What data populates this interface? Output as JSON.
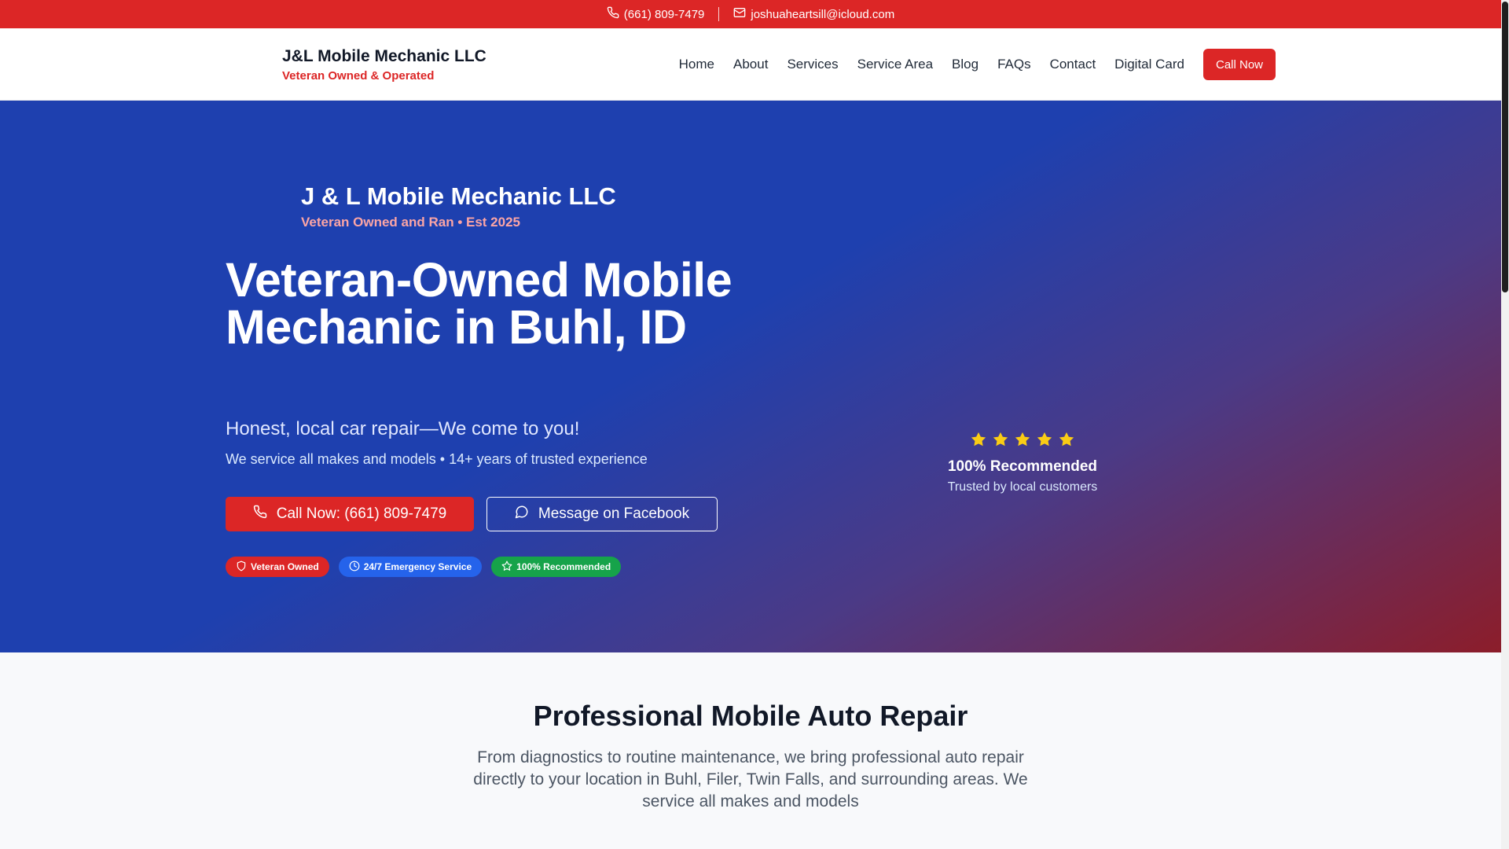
{
  "topbar": {
    "phone": "(661) 809-7479",
    "email": "joshuaheartsill@icloud.com"
  },
  "header": {
    "brand_name": "J&L Mobile Mechanic LLC",
    "brand_tagline": "Veteran Owned & Operated",
    "nav": [
      "Home",
      "About",
      "Services",
      "Service Area",
      "Blog",
      "FAQs",
      "Contact",
      "Digital Card"
    ],
    "call_button": "Call Now"
  },
  "hero": {
    "logo_name": "J & L Mobile Mechanic LLC",
    "logo_sub": "Veteran Owned and Ran • Est 2025",
    "title": "Veteran-Owned Mobile Mechanic in Buhl, ID",
    "tagline": "Honest, local car repair—We come to you!",
    "description": "We service all makes and models • 14+ years of trusted experience",
    "call_button": "Call Now: (661) 809-7479",
    "facebook_button": "Message on Facebook",
    "badges": [
      "Veteran Owned",
      "24/7 Emergency Service",
      "100% Recommended"
    ],
    "rating": {
      "stars": 5,
      "title": "100% Recommended",
      "subtitle": "Trusted by local customers"
    }
  },
  "section": {
    "title": "Professional Mobile Auto Repair",
    "text": "From diagnostics to routine maintenance, we bring professional auto repair directly to your location in Buhl, Filer, Twin Falls, and surrounding areas. We service all makes and models"
  },
  "colors": {
    "brand_red": "#dc2626",
    "hero_blue": "#1e40af",
    "star_yellow": "#facc15",
    "badge_blue": "#2563eb",
    "badge_green": "#16a34a"
  }
}
